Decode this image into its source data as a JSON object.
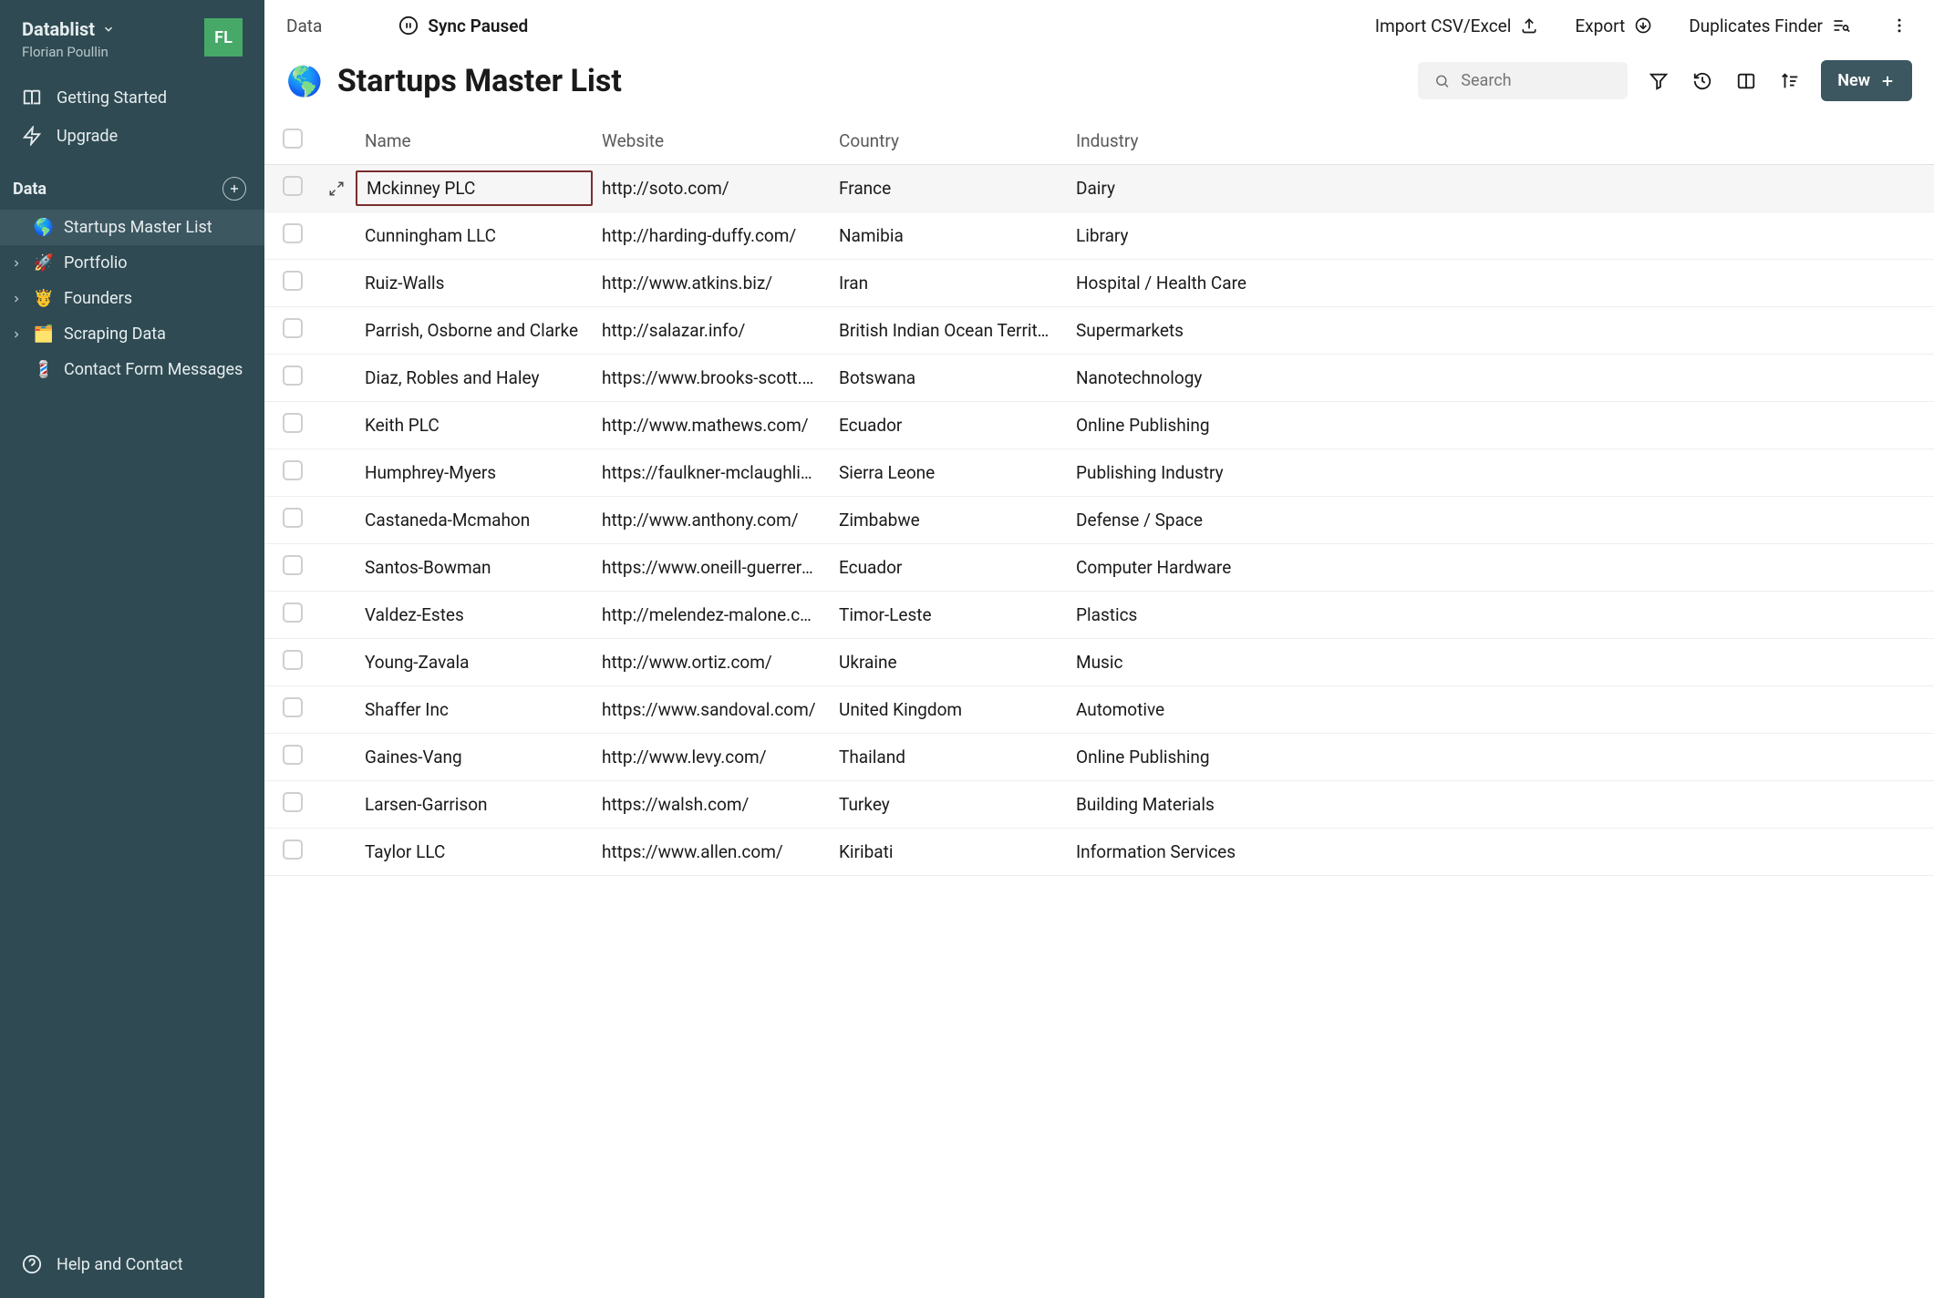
{
  "workspace": {
    "name": "Datablist",
    "user": "Florian Poullin",
    "avatar_initials": "FL"
  },
  "sidebar": {
    "nav": [
      {
        "icon": "book",
        "label": "Getting Started"
      },
      {
        "icon": "bolt",
        "label": "Upgrade"
      }
    ],
    "section_label": "Data",
    "tree": [
      {
        "emoji": "🌎",
        "label": "Startups Master List",
        "active": true,
        "expandable": false
      },
      {
        "emoji": "🚀",
        "label": "Portfolio",
        "active": false,
        "expandable": true
      },
      {
        "emoji": "🤴",
        "label": "Founders",
        "active": false,
        "expandable": true
      },
      {
        "emoji": "🗂️",
        "label": "Scraping Data",
        "active": false,
        "expandable": true
      },
      {
        "emoji": "💈",
        "label": "Contact Form Messages",
        "active": false,
        "expandable": false
      }
    ],
    "help_label": "Help and Contact"
  },
  "topbar": {
    "breadcrumb": "Data",
    "sync_label": "Sync Paused",
    "import_label": "Import CSV/Excel",
    "export_label": "Export",
    "dupes_label": "Duplicates Finder"
  },
  "header": {
    "emoji": "🌎",
    "title": "Startups Master List",
    "search_placeholder": "Search",
    "new_label": "New"
  },
  "table": {
    "columns": [
      "Name",
      "Website",
      "Country",
      "Industry"
    ],
    "rows": [
      {
        "name": "Mckinney PLC",
        "website": "http://soto.com/",
        "country": "France",
        "industry": "Dairy",
        "active": true
      },
      {
        "name": "Cunningham LLC",
        "website": "http://harding-duffy.com/",
        "country": "Namibia",
        "industry": "Library"
      },
      {
        "name": "Ruiz-Walls",
        "website": "http://www.atkins.biz/",
        "country": "Iran",
        "industry": "Hospital / Health Care"
      },
      {
        "name": "Parrish, Osborne and Clarke",
        "website": "http://salazar.info/",
        "country": "British Indian Ocean Territor...",
        "industry": "Supermarkets"
      },
      {
        "name": "Diaz, Robles and Haley",
        "website": "https://www.brooks-scott.n...",
        "country": "Botswana",
        "industry": "Nanotechnology"
      },
      {
        "name": "Keith PLC",
        "website": "http://www.mathews.com/",
        "country": "Ecuador",
        "industry": "Online Publishing"
      },
      {
        "name": "Humphrey-Myers",
        "website": "https://faulkner-mclaughlin....",
        "country": "Sierra Leone",
        "industry": "Publishing Industry"
      },
      {
        "name": "Castaneda-Mcmahon",
        "website": "http://www.anthony.com/",
        "country": "Zimbabwe",
        "industry": "Defense / Space"
      },
      {
        "name": "Santos-Bowman",
        "website": "https://www.oneill-guerrero....",
        "country": "Ecuador",
        "industry": "Computer Hardware"
      },
      {
        "name": "Valdez-Estes",
        "website": "http://melendez-malone.co...",
        "country": "Timor-Leste",
        "industry": "Plastics"
      },
      {
        "name": "Young-Zavala",
        "website": "http://www.ortiz.com/",
        "country": "Ukraine",
        "industry": "Music"
      },
      {
        "name": "Shaffer Inc",
        "website": "https://www.sandoval.com/",
        "country": "United Kingdom",
        "industry": "Automotive"
      },
      {
        "name": "Gaines-Vang",
        "website": "http://www.levy.com/",
        "country": "Thailand",
        "industry": "Online Publishing"
      },
      {
        "name": "Larsen-Garrison",
        "website": "https://walsh.com/",
        "country": "Turkey",
        "industry": "Building Materials"
      },
      {
        "name": "Taylor LLC",
        "website": "https://www.allen.com/",
        "country": "Kiribati",
        "industry": "Information Services"
      }
    ]
  }
}
